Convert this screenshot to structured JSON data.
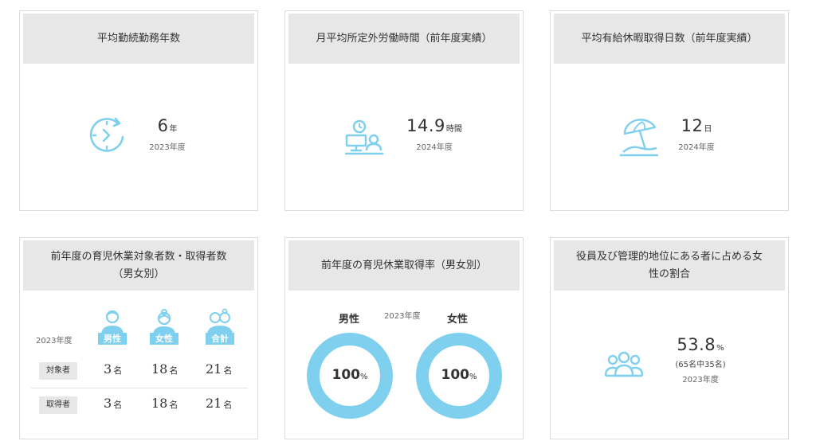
{
  "cards": {
    "tenure": {
      "title": "平均勤続勤務年数",
      "icon": "clock-icon",
      "value": "6",
      "unit": "年",
      "year": "2023年度"
    },
    "overtime": {
      "title": "月平均所定外労働時間（前年度実績）",
      "icon": "desk-worker-icon",
      "value": "14.9",
      "unit": "時間",
      "year": "2024年度"
    },
    "leave": {
      "title": "平均有給休暇取得日数（前年度実績）",
      "icon": "beach-umbrella-icon",
      "value": "12",
      "unit": "日",
      "year": "2024年度"
    },
    "childcare": {
      "title_line1": "前年度の育児休業対象者数・取得者数",
      "title_line2": "（男女別）",
      "year": "2023年度",
      "columns": [
        "男性",
        "女性",
        "合計"
      ],
      "unit": "名",
      "rows": [
        {
          "label": "対象者",
          "values": [
            "3",
            "18",
            "21"
          ]
        },
        {
          "label": "取得者",
          "values": [
            "3",
            "18",
            "21"
          ]
        }
      ]
    },
    "childcare_rate": {
      "title": "前年度の育児休業取得率（男女別）",
      "year": "2023年度",
      "male_label": "男性",
      "female_label": "女性",
      "male_rate": "100",
      "female_rate": "100",
      "pct_unit": "%"
    },
    "women_managers": {
      "title_line1": "役員及び管理的地位にある者に占める女",
      "title_line2": "性の割合",
      "icon": "group-icon",
      "value": "53.8",
      "unit": "%",
      "sub": "(65名中35名)",
      "year": "2023年度"
    }
  },
  "colors": {
    "accent": "#7fd0ee",
    "header_bg": "#e7e7e7",
    "border": "#dcdcdc"
  }
}
